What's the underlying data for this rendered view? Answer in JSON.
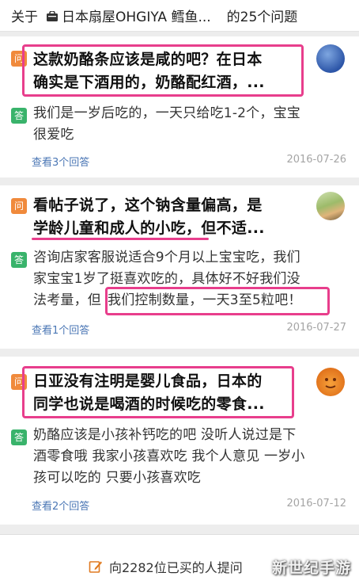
{
  "header": {
    "prefix": "关于",
    "store": "日本扇屋OHGIYA 鳕鱼...",
    "count": "的25个问题"
  },
  "badges": {
    "question": "问",
    "answer": "答"
  },
  "questions": [
    {
      "q_line1": "这款奶酪条应该是咸的吧？在日本",
      "q_line2": "确实是下酒用的，奶酪配红酒，...",
      "a_line1": "我们是一岁后吃的，一天只给吃1-2个，宝宝",
      "a_line2": "很爱吃",
      "answers_link": "查看3个回答",
      "date": "2016-07-26"
    },
    {
      "q_line1": "看帖子说了，这个钠含量偏高，是",
      "q_line2a": "学龄儿童和成人的小吃",
      "q_line2b": "，但不适...",
      "a_line1": "咨询店家客服说适合9个月以上宝宝吃，我们",
      "a_line2": "家宝宝1岁了挺喜欢吃的，具体好不好我们没",
      "a_line3a": "法考量，但",
      "a_line3b": "我们控制数量，一天3至5粒吧！",
      "answers_link": "查看1个回答",
      "date": "2016-07-27"
    },
    {
      "q_line1": "日亚没有注明是婴儿食品，日本的",
      "q_line2": "同学也说是喝酒的时候吃的零食...",
      "a_line1": "奶酪应该是小孩补钙吃的吧 没听人说过是下",
      "a_line2": "酒零食哦 我家小孩喜欢吃 我个人意见 一岁小",
      "a_line3": "孩可以吃的 只要小孩喜欢吃",
      "answers_link": "查看2个回答",
      "date": "2016-07-12"
    }
  ],
  "footer": {
    "ask_label": "向2282位已买的人提问"
  },
  "watermark": "新世纪手游",
  "colors": {
    "highlight": "#e83e8c",
    "question_badge": "#f08a3c",
    "answer_badge": "#39b36b",
    "link": "#4b77b5"
  },
  "icons": [
    "shopping-bag-icon",
    "edit-pen-icon",
    "avatar-blue",
    "avatar-photo",
    "avatar-orange-emoji"
  ]
}
